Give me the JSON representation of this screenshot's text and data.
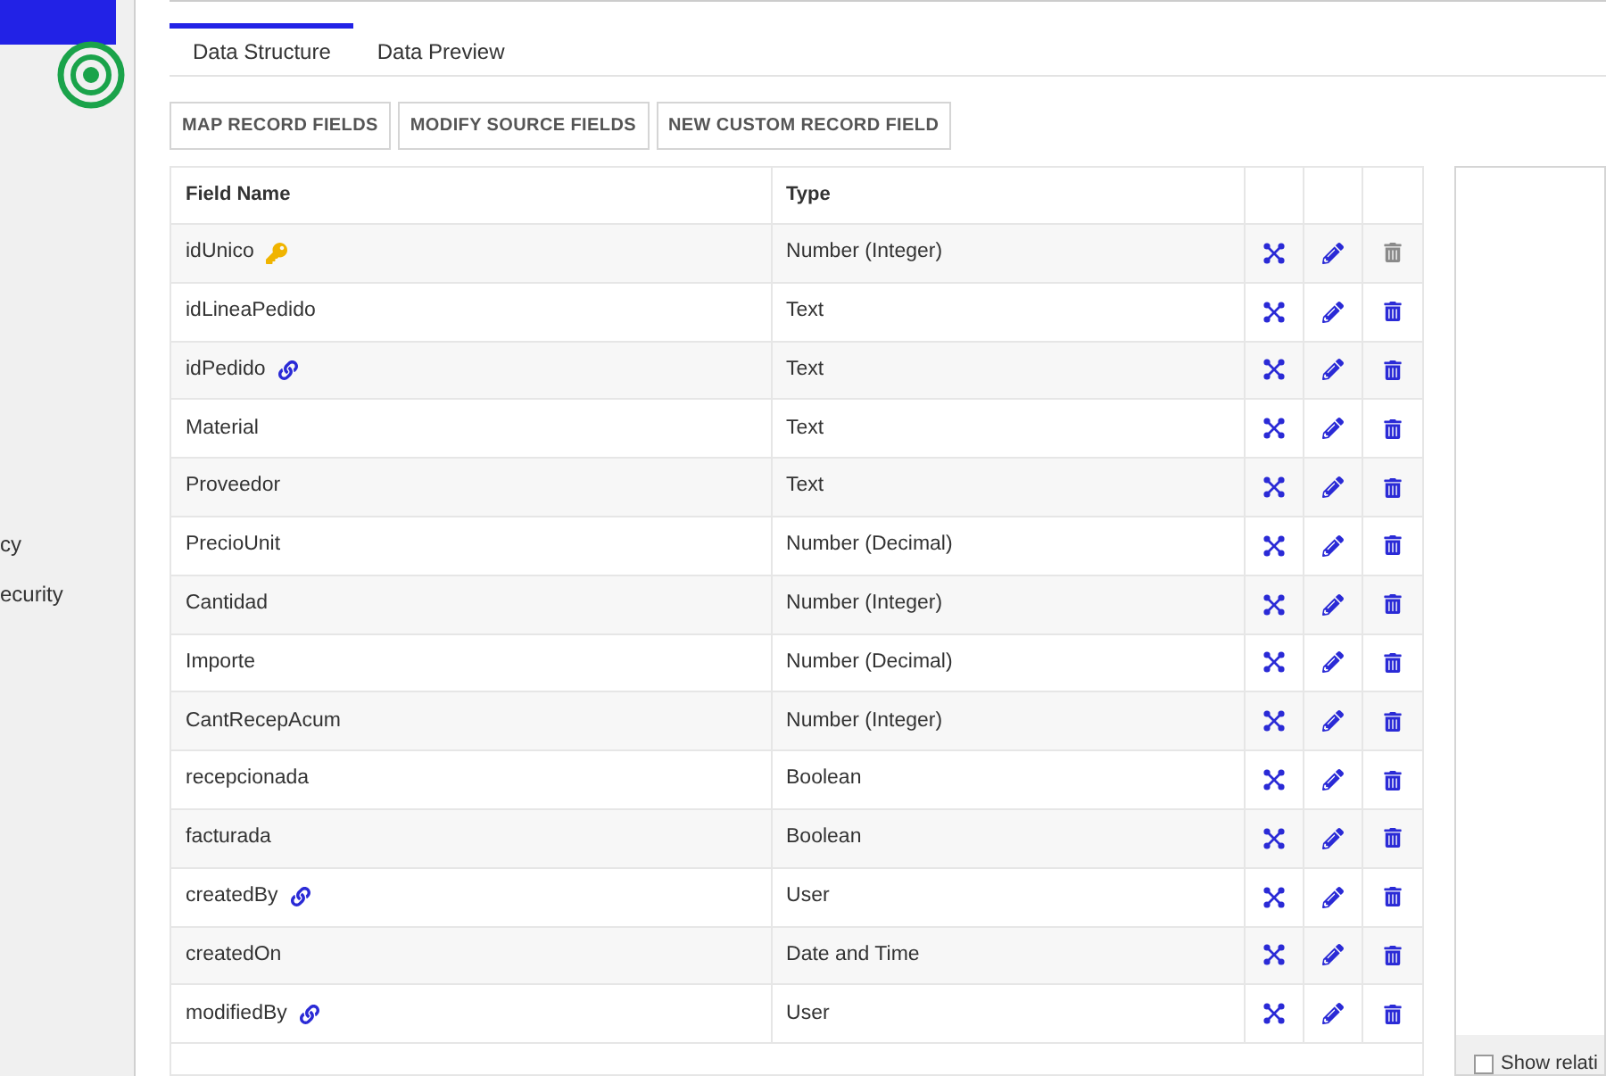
{
  "sidebar": {
    "items": [
      {
        "label": "cy"
      },
      {
        "label": "ecurity"
      }
    ]
  },
  "tabs": [
    {
      "label": "Data Structure",
      "selected": true
    },
    {
      "label": "Data Preview",
      "selected": false
    }
  ],
  "toolbar": {
    "buttons": [
      "MAP RECORD FIELDS",
      "MODIFY SOURCE FIELDS",
      "NEW CUSTOM RECORD FIELD"
    ]
  },
  "table": {
    "columns": [
      "Field Name",
      "Type"
    ],
    "rows": [
      {
        "name": "idUnico",
        "kind": "key",
        "type": "Number (Integer)",
        "delete_disabled": true
      },
      {
        "name": "idLineaPedido",
        "kind": "plain",
        "type": "Text",
        "delete_disabled": false
      },
      {
        "name": "idPedido",
        "kind": "link",
        "type": "Text",
        "delete_disabled": false
      },
      {
        "name": "Material",
        "kind": "plain",
        "type": "Text",
        "delete_disabled": false
      },
      {
        "name": "Proveedor",
        "kind": "plain",
        "type": "Text",
        "delete_disabled": false
      },
      {
        "name": "PrecioUnit",
        "kind": "plain",
        "type": "Number (Decimal)",
        "delete_disabled": false
      },
      {
        "name": "Cantidad",
        "kind": "plain",
        "type": "Number (Integer)",
        "delete_disabled": false
      },
      {
        "name": "Importe",
        "kind": "plain",
        "type": "Number (Decimal)",
        "delete_disabled": false
      },
      {
        "name": "CantRecepAcum",
        "kind": "plain",
        "type": "Number (Integer)",
        "delete_disabled": false
      },
      {
        "name": "recepcionada",
        "kind": "plain",
        "type": "Boolean",
        "delete_disabled": false
      },
      {
        "name": "facturada",
        "kind": "plain",
        "type": "Boolean",
        "delete_disabled": false
      },
      {
        "name": "createdBy",
        "kind": "link",
        "type": "User",
        "delete_disabled": false
      },
      {
        "name": "createdOn",
        "kind": "plain",
        "type": "Date and Time",
        "delete_disabled": false
      },
      {
        "name": "modifiedBy",
        "kind": "link",
        "type": "User",
        "delete_disabled": false
      }
    ]
  },
  "side_panel": {
    "checkbox": {
      "label": "Show relati",
      "checked": false
    }
  }
}
